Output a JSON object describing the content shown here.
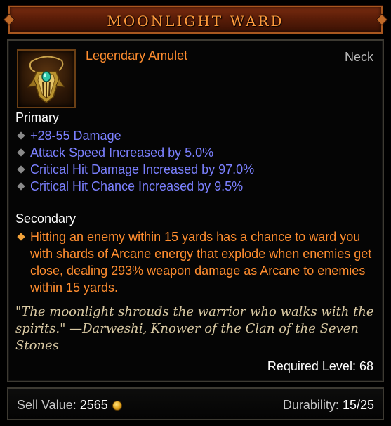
{
  "item": {
    "name": "MOONLIGHT WARD",
    "type": "Legendary Amulet",
    "slot": "Neck",
    "icon": "amulet-icon"
  },
  "primary": {
    "label": "Primary",
    "affixes": [
      "+28-55 Damage",
      "Attack Speed Increased by 5.0%",
      "Critical Hit Damage Increased by 97.0%",
      "Critical Hit Chance Increased by 9.5%"
    ]
  },
  "secondary": {
    "label": "Secondary",
    "text": "Hitting an enemy within 15 yards has a chance to ward you with shards of Arcane energy that explode when enemies get close, dealing 293% weapon damage as Arcane to enemies within 15 yards."
  },
  "flavor": "\"The moonlight shrouds the warrior who walks with the spirits.\" —Darweshi, Knower of the Clan of the Seven Stones",
  "required_level": {
    "label": "Required Level:",
    "value": "68"
  },
  "footer": {
    "sell_label": "Sell Value:",
    "sell_value": "2565",
    "durability_label": "Durability:",
    "durability_value": "15/25"
  },
  "colors": {
    "legendary": "#ff8d2f",
    "magic_affix": "#7b80ff",
    "flavor": "#d9c9a3"
  }
}
